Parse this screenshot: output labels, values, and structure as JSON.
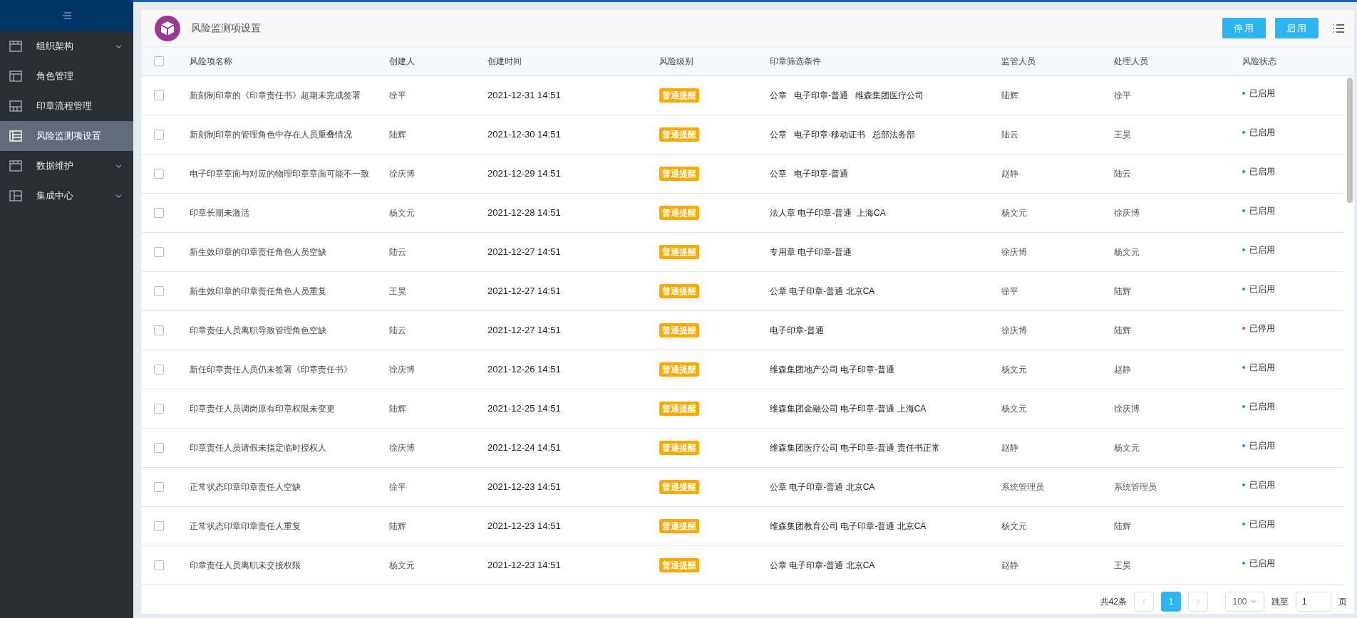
{
  "sidebar": {
    "items": [
      {
        "label": "组织架构",
        "kind": "grid",
        "expandable": true,
        "selected": false
      },
      {
        "label": "角色管理",
        "kind": "layout",
        "expandable": false,
        "selected": false
      },
      {
        "label": "印章流程管理",
        "kind": "bottom",
        "expandable": false,
        "selected": false
      },
      {
        "label": "风险监测项设置",
        "kind": "list",
        "expandable": false,
        "selected": true
      },
      {
        "label": "数据维护",
        "kind": "grid",
        "expandable": true,
        "selected": false
      },
      {
        "label": "集成中心",
        "kind": "side",
        "expandable": true,
        "selected": false
      }
    ]
  },
  "page": {
    "title": "风险监测项设置",
    "buttons": [
      "停用",
      "启用"
    ]
  },
  "table": {
    "columns": [
      "风险项名称",
      "创建人",
      "创建时间",
      "风险级别",
      "印章筛选条件",
      "监管人员",
      "处理人员",
      "风险状态"
    ],
    "header_checked": false,
    "rows": [
      {
        "checked": false,
        "name": "新刻制印章的《印章责任书》超期未完成签署",
        "creator": "徐平",
        "time": "2021-12-31 14:51",
        "level": "普通提醒",
        "condition": "公章   电子印章-普通   维森集团医疗公司",
        "supervisor": "陆辉",
        "handler": "徐平",
        "status": "已启用",
        "color": "#1e88e5"
      },
      {
        "checked": false,
        "name": "新刻制印章的管理角色中存在人员重叠情况",
        "creator": "陆辉",
        "time": "2021-12-30 14:51",
        "level": "普通提醒",
        "condition": "公章   电子印章-移动证书   总部法务部",
        "supervisor": "陆云",
        "handler": "王昊",
        "status": "已启用",
        "color": "#1e88e5"
      },
      {
        "checked": false,
        "name": "电子印章章面与对应的物理印章章面可能不一致",
        "creator": "徐庆博",
        "time": "2021-12-29 14:51",
        "level": "普通提醒",
        "condition": "公章   电子印章-普通",
        "supervisor": "赵静",
        "handler": "陆云",
        "status": "已启用",
        "color": "#1e88e5"
      },
      {
        "checked": false,
        "name": "印章长期未激活",
        "creator": "杨文元",
        "time": "2021-12-28 14:51",
        "level": "普通提醒",
        "condition": "法人章 电子印章-普通  上海CA",
        "supervisor": "杨文元",
        "handler": "徐庆博",
        "status": "已启用",
        "color": "#1e88e5"
      },
      {
        "checked": false,
        "name": "新生效印章的印章责任角色人员空缺",
        "creator": "陆云",
        "time": "2021-12-27 14:51",
        "level": "普通提醒",
        "condition": "专用章 电子印章-普通",
        "supervisor": "徐庆博",
        "handler": "杨文元",
        "status": "已启用",
        "color": "#1e88e5"
      },
      {
        "checked": false,
        "name": "新生效印章的印章责任角色人员重复",
        "creator": "王昊",
        "time": "2021-12-27 14:51",
        "level": "普通提醒",
        "condition": "公章 电子印章-普通 北京CA",
        "supervisor": "徐平",
        "handler": "陆辉",
        "status": "已启用",
        "color": "#1e88e5"
      },
      {
        "checked": false,
        "name": "印章责任人员离职导致管理角色空缺",
        "creator": "陆云",
        "time": "2021-12-27 14:51",
        "level": "普通提醒",
        "condition": "电子印章-普通",
        "supervisor": "徐庆博",
        "handler": "陆辉",
        "status": "已停用",
        "color": "#f44336"
      },
      {
        "checked": false,
        "name": "新任印章责任人员仍未签署《印章责任书》",
        "creator": "徐庆博",
        "time": "2021-12-26 14:51",
        "level": "普通提醒",
        "condition": "维森集团地产公司 电子印章-普通",
        "supervisor": "杨文元",
        "handler": "赵静",
        "status": "已启用",
        "color": "#1e88e5"
      },
      {
        "checked": false,
        "name": "印章责任人员调岗原有印章权限未变更",
        "creator": "陆辉",
        "time": "2021-12-25 14:51",
        "level": "普通提醒",
        "condition": "维森集团金融公司 电子印章-普通 上海CA",
        "supervisor": "杨文元",
        "handler": "徐庆博",
        "status": "已启用",
        "color": "#1e88e5"
      },
      {
        "checked": false,
        "name": "印章责任人员请假未指定临时授权人",
        "creator": "徐庆博",
        "time": "2021-12-24 14:51",
        "level": "普通提醒",
        "condition": "维森集团医疗公司 电子印章-普通 责任书正常",
        "supervisor": "赵静",
        "handler": "杨文元",
        "status": "已启用",
        "color": "#1e88e5"
      },
      {
        "checked": false,
        "name": "正常状态印章印章责任人空缺",
        "creator": "徐平",
        "time": "2021-12-23 14:51",
        "level": "普通提醒",
        "condition": "公章 电子印章-普通 北京CA",
        "supervisor": "系统管理员",
        "handler": "系统管理员",
        "status": "已启用",
        "color": "#1e88e5"
      },
      {
        "checked": false,
        "name": "正常状态印章印章责任人重复",
        "creator": "陆辉",
        "time": "2021-12-23 14:51",
        "level": "普通提醒",
        "condition": "维森集团教育公司 电子印章-普通 北京CA",
        "supervisor": "杨文元",
        "handler": "陆辉",
        "status": "已启用",
        "color": "#1e88e5"
      },
      {
        "checked": false,
        "name": "印章责任人员离职未交接权限",
        "creator": "杨文元",
        "time": "2021-12-23 14:51",
        "level": "普通提醒",
        "condition": "公章 电子印章-普通 北京CA",
        "supervisor": "赵静",
        "handler": "王昊",
        "status": "已启用",
        "color": "#1e88e5"
      }
    ]
  },
  "pagination": {
    "total": "共42条",
    "pages": [
      {
        "label": "1",
        "selected": true
      }
    ],
    "page_size": "100",
    "jump_label": "跳至",
    "jump_value": "1",
    "page_unit": "页"
  }
}
